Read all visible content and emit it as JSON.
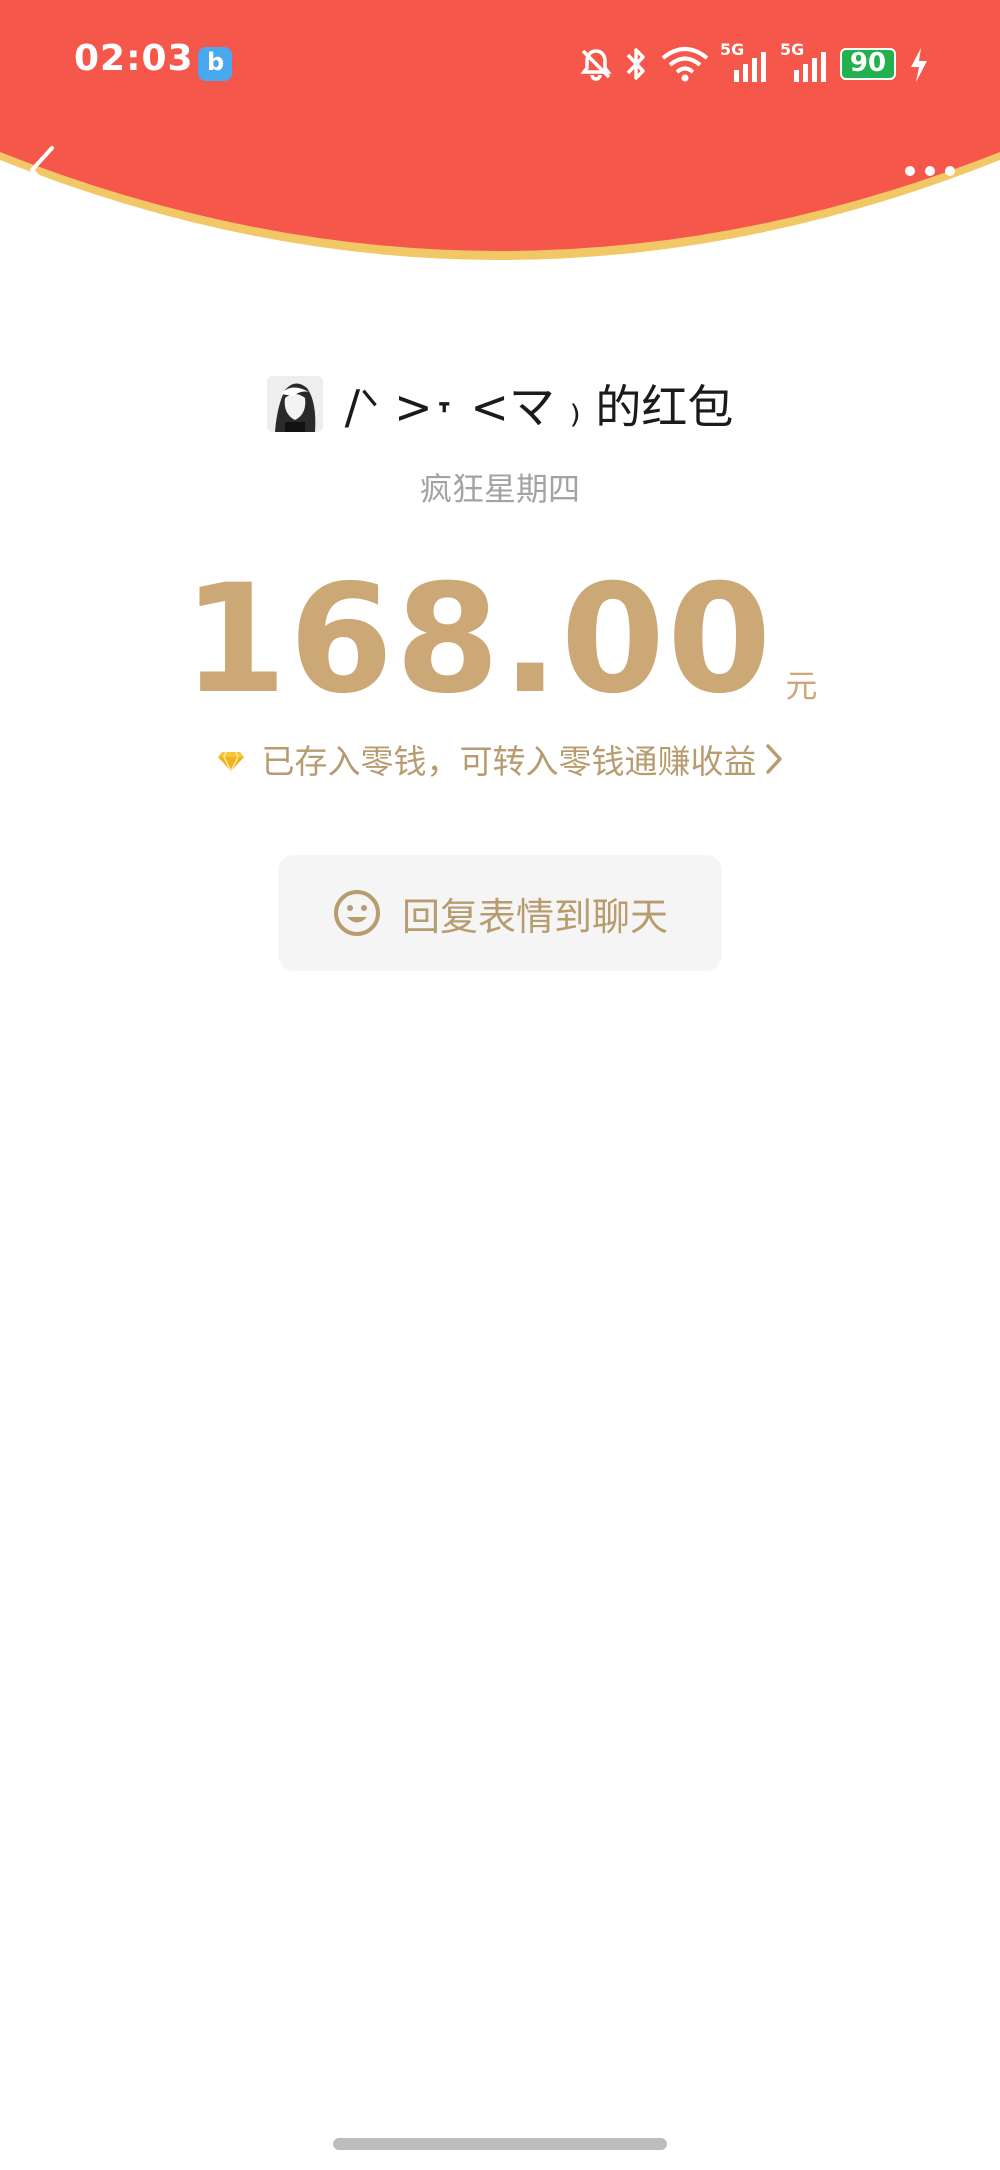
{
  "status_bar": {
    "time": "02:03",
    "battery": "90",
    "network_label_1": "5G",
    "network_label_2": "5G"
  },
  "header": {
    "background_color": "#f5574a",
    "rim_color": "#f2c866",
    "back_icon": "chevron-left-icon",
    "more_icon": "more-dots-icon"
  },
  "packet": {
    "sender_title": "/ᐠ >˕ <マ ₎ 的红包",
    "greeting": "疯狂星期四",
    "amount": "168.00",
    "unit": "元",
    "deposit_note": "已存入零钱，可转入零钱通赚收益",
    "reply_button": "回复表情到聊天",
    "accent_color": "#cda877"
  }
}
